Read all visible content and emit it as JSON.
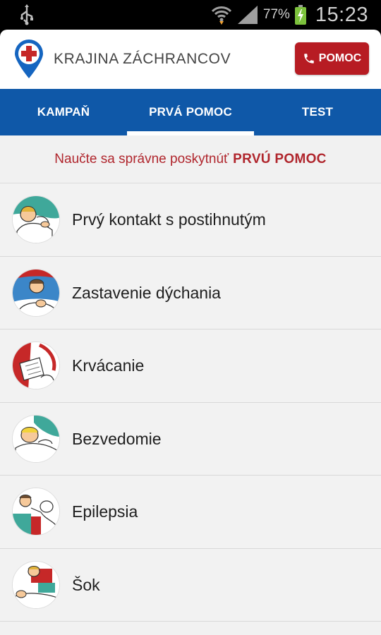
{
  "status_bar": {
    "battery_percent": "77%",
    "time": "15:23"
  },
  "app": {
    "title": "KRAJINA ZÁCHRANCOV",
    "sos_button_label": "POMOC"
  },
  "tabs": [
    {
      "label": "KAMPAŇ",
      "active": false
    },
    {
      "label": "PRVÁ POMOC",
      "active": true
    },
    {
      "label": "TEST",
      "active": false
    }
  ],
  "subtitle": {
    "text": "Naučte sa správne poskytnúť",
    "highlight": "PRVÚ POMOC"
  },
  "items": [
    {
      "label": "Prvý kontakt s postihnutým",
      "icon": "first-contact-illustration"
    },
    {
      "label": "Zastavenie dýchania",
      "icon": "breathing-stop-illustration"
    },
    {
      "label": "Krvácanie",
      "icon": "bleeding-illustration"
    },
    {
      "label": "Bezvedomie",
      "icon": "unconscious-illustration"
    },
    {
      "label": "Epilepsia",
      "icon": "epilepsy-illustration"
    },
    {
      "label": "Šok",
      "icon": "shock-illustration"
    }
  ],
  "colors": {
    "brand_blue": "#0f58a8",
    "brand_red": "#b71c23",
    "subtitle_red": "#b0262d"
  }
}
